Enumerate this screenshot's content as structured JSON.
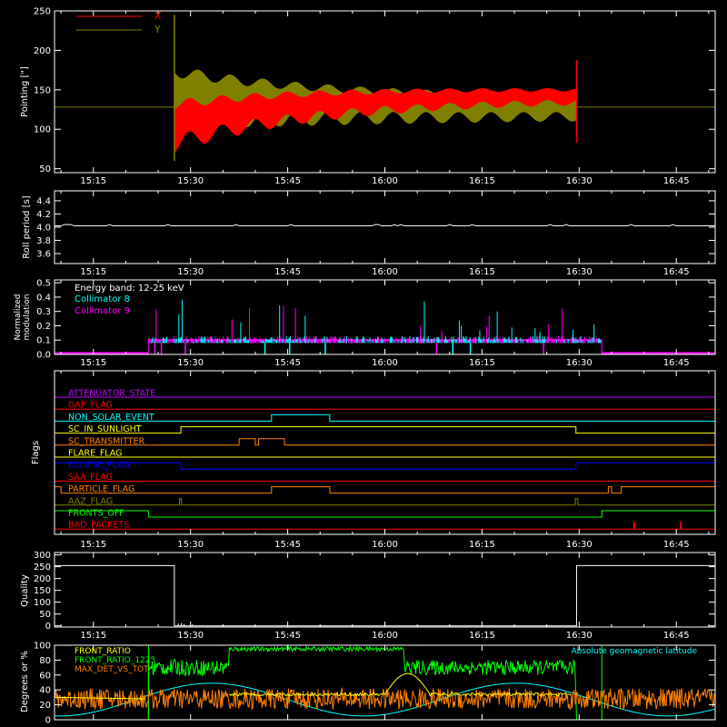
{
  "colors": {
    "background": "#000000",
    "axes": "#ffffff",
    "red": "#ff0000",
    "olive": "#808000",
    "cyan": "#00ffff",
    "magenta": "#ff00ff",
    "orange": "#ff8000",
    "yellow": "#ffff00",
    "green": "#00ff00",
    "blue": "#0000ff",
    "purple": "#c000ff",
    "lightgreen": "#80ff80"
  },
  "chart_data": [
    {
      "id": "pointing",
      "type": "area",
      "ylabel": "Pointing [\"]",
      "ylim": [
        45,
        250
      ],
      "yticks": [
        50,
        100,
        150,
        200,
        250
      ],
      "xticks": [
        "15:15",
        "15:30",
        "15:45",
        "16:00",
        "16:15",
        "16:30",
        "16:45"
      ],
      "xtick_minutes": [
        915,
        930,
        945,
        960,
        975,
        990,
        1005
      ],
      "xlim_minutes": [
        909,
        1011
      ],
      "legend": "top-left",
      "series": [
        {
          "name": "X",
          "color": "#ff0000",
          "center_start": 110,
          "center_end": 145,
          "amp_start": 50,
          "amp_end": 12,
          "center": 128
        },
        {
          "name": "Y",
          "color": "#808000",
          "center_start": 148,
          "center_end": 130,
          "amp_start": 60,
          "amp_end": 22,
          "center": 128
        }
      ],
      "active_range_minutes": [
        927.5,
        989.6
      ],
      "spike_at_end": {
        "high": 188,
        "low": 83
      }
    },
    {
      "id": "roll",
      "type": "line",
      "ylabel": "Roll period [s]",
      "ylim": [
        3.45,
        4.55
      ],
      "yticks": [
        3.6,
        3.8,
        4.0,
        4.2,
        4.4
      ],
      "ytick_labels": [
        "3.6",
        "3.8",
        "4.0",
        "4.2",
        "4.4"
      ],
      "xticks": [
        "15:15",
        "15:30",
        "15:45",
        "16:00",
        "16:15",
        "16:30",
        "16:45"
      ],
      "value": 4.02,
      "color": "#ffffff"
    },
    {
      "id": "modulation",
      "type": "bar",
      "ylabel": "Normalized modulation",
      "ylabel_lines": [
        "Normalized",
        "modulation"
      ],
      "ylim": [
        0,
        0.52
      ],
      "yticks": [
        0,
        0.1,
        0.2,
        0.3,
        0.4,
        0.5
      ],
      "ytick_labels": [
        "0.0",
        "0.1",
        "0.2",
        "0.3",
        "0.4",
        "0.5"
      ],
      "xticks": [
        "15:15",
        "15:30",
        "15:45",
        "16:00",
        "16:15",
        "16:30",
        "16:45"
      ],
      "legend_title": "Energy band: 12-25 keV",
      "series": [
        {
          "name": "Collimator 8",
          "color": "#00ffff"
        },
        {
          "name": "Collimator 9",
          "color": "#ff00ff"
        }
      ],
      "active_range_minutes": [
        923.5,
        993.5
      ],
      "baseline": 0.1
    },
    {
      "id": "flags",
      "type": "line",
      "ylabel": "Flags",
      "xticks": [
        "15:15",
        "15:30",
        "15:45",
        "16:00",
        "16:15",
        "16:30",
        "16:45"
      ],
      "series": [
        {
          "name": "ATTENUATOR_STATE",
          "color": "#c000ff",
          "high": []
        },
        {
          "name": "GAP_FLAG",
          "color": "#ff0000",
          "high": []
        },
        {
          "name": "NON_SOLAR_EVENT",
          "color": "#00ffff",
          "high": [
            [
              942.5,
              951.5
            ]
          ]
        },
        {
          "name": "SC_IN_SUNLIGHT",
          "color": "#ffff00",
          "high": [
            [
              928.5,
              989.5
            ]
          ]
        },
        {
          "name": "SC_TRANSMITTER",
          "color": "#ff8000",
          "high": [
            [
              937.5,
              940
            ],
            [
              940.5,
              944.5
            ]
          ]
        },
        {
          "name": "FLARE_FLAG",
          "color": "#ffff00",
          "high": []
        },
        {
          "name": "ECLIPSE_FLAG",
          "color": "#0000ff",
          "high": [
            [
              909,
              928.5
            ],
            [
              989.5,
              1011
            ]
          ]
        },
        {
          "name": "SAA_FLAG",
          "color": "#ff0000",
          "high": []
        },
        {
          "name": "PARTICLE_FLAG",
          "color": "#ff8000",
          "high": [
            [
              909,
              910
            ],
            [
              942.5,
              951.5
            ],
            [
              994.5,
              995
            ],
            [
              996.5,
              1011
            ]
          ]
        },
        {
          "name": "AAZ_FLAG",
          "color": "#808000",
          "high": [
            [
              928.3,
              928.6
            ],
            [
              989.4,
              989.8
            ]
          ]
        },
        {
          "name": "FRONTS_OFF",
          "color": "#00ff00",
          "high": [
            [
              909,
              923.5
            ],
            [
              993.5,
              1011
            ]
          ]
        },
        {
          "name": "BAD_PACKETS",
          "color": "#ff0000",
          "high": []
        }
      ],
      "bad_packet_spikes": [
        998.5,
        1005.7
      ]
    },
    {
      "id": "quality",
      "type": "line",
      "ylabel": "Quality",
      "ylim": [
        -5,
        310
      ],
      "yticks": [
        0,
        50,
        100,
        150,
        200,
        250,
        300
      ],
      "xticks": [
        "15:15",
        "15:30",
        "15:45",
        "16:00",
        "16:15",
        "16:30",
        "16:45"
      ],
      "value_high": 255,
      "high_ranges": [
        [
          909,
          927.5
        ],
        [
          989.6,
          1011
        ]
      ],
      "color": "#ffffff"
    },
    {
      "id": "ratios",
      "type": "line",
      "ylabel": "Degrees or %",
      "ylim": [
        0,
        100
      ],
      "yticks": [
        0,
        20,
        40,
        60,
        80,
        100
      ],
      "legend_right": "Absolute geomagnetic latitude",
      "series": [
        {
          "name": "FRONT_RATIO",
          "color": "#ffff00"
        },
        {
          "name": "FRONT_RATIO_1225",
          "color": "#00ff00"
        },
        {
          "name": "MAX_DET_VS_TOT",
          "color": "#ff8000"
        }
      ],
      "latitude_color": "#00ffff"
    }
  ]
}
